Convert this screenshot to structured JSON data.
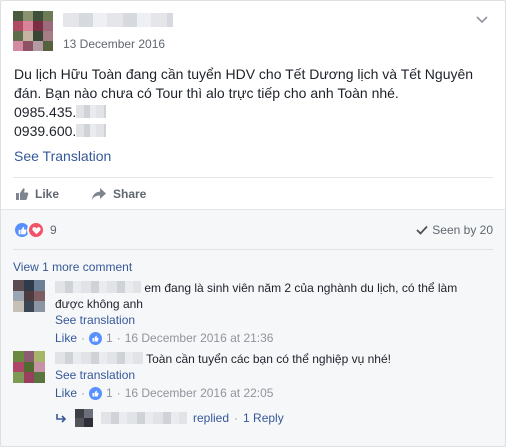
{
  "post": {
    "date": "13 December 2016",
    "text_lines": [
      "Du lịch Hữu Toàn đang cần tuyển HDV cho Tết Dương lịch và Tết Nguyên",
      "đán. Bạn nào chưa có Tour thì alo trực tiếp cho anh Toàn nhé."
    ],
    "phone_1": "0985.435.",
    "phone_2": "0939.600.",
    "see_translation": "See Translation"
  },
  "actions": {
    "like": "Like",
    "share": "Share"
  },
  "reactions": {
    "count": "9",
    "seen_by": "Seen by 20"
  },
  "view_more_comments": "View 1 more comment",
  "comments": [
    {
      "text_line_1": "em đang là sinh viên năm 2 của nghành du lịch, có thể làm",
      "text_line_2": "được không anh",
      "see_translation": "See translation",
      "like": "Like",
      "like_count": "1",
      "timestamp": "16 December 2016 at 21:36"
    },
    {
      "text_line_1": "Toàn cần tuyển các bạn có thể nghiệp vụ nhé!",
      "see_translation": "See translation",
      "like": "Like",
      "like_count": "1",
      "timestamp": "16 December 2016 at 22:05"
    }
  ],
  "reply_summary": {
    "replied": "replied",
    "separator": "·",
    "reply_count": "1 Reply"
  },
  "colors": {
    "link": "#365899",
    "like_blue": "#5890ff",
    "love_red": "#f25268",
    "muted": "#90949c"
  }
}
